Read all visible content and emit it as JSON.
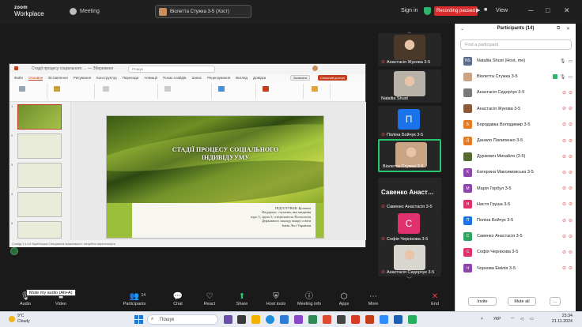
{
  "topbar": {
    "logo_line1": "zoom",
    "logo_line2": "Workplace",
    "meeting_label": "Meeting",
    "pinned_speaker": "Віолетта Стужка 3-5 (Хост)",
    "sign_in": "Sign in",
    "recording_label": "Recording paused",
    "view_label": "View",
    "colors": {
      "recording": "#d92b2b",
      "secure": "#2fb56b"
    }
  },
  "ppt": {
    "title_text": "Стадії процесу соціального … — Збережено",
    "search_placeholder": "Пошук",
    "menu": [
      "Файл",
      "Основне",
      "Вставлення",
      "Рисування",
      "Конструктор",
      "Переходи",
      "Анімації",
      "Показ слайдів",
      "Запис",
      "Рецензування",
      "Вигляд",
      "Довідка"
    ],
    "active_menu": "Основне",
    "record_btn": "Записати",
    "share_btn": "Спільний доступ",
    "slide_numbers": [
      "1",
      "2",
      "3",
      "4",
      "5"
    ],
    "slide_heading_line1": "СТАДІЇ ПРОЦЕСУ СОЦІАЛЬНОГО",
    "slide_heading_line2": "ІНДИВІДУУМУ",
    "slide_body": [
      "ПІДГОТУВАВ: Кузьмич",
      "Федорчук: слухачка, яка завдання",
      "курс 5, група 5, спеціальність Психологія",
      "Державного закладу вищої освіти",
      "Імені Лесі Українки"
    ],
    "status_text": "Слайд 1 з 14   Українська   Спеціальні можливості: потрібно переглянути"
  },
  "video_tiles": [
    {
      "name": "Анастасія Жукова 3-5",
      "kind": "photo",
      "muted": true,
      "color": "#4a3828"
    },
    {
      "name": "Nataliia Shust",
      "kind": "photo",
      "muted": false,
      "color": "#b8b2a8"
    },
    {
      "name": "Поліна Бойчук 3-5",
      "kind": "avatar",
      "letter": "П",
      "muted": true,
      "color": "#1a73e8"
    },
    {
      "name": "Віолетта Стужка 3-5",
      "kind": "photo",
      "muted": false,
      "color": "#c9a586",
      "highlighted": true
    },
    {
      "name": "Савенко Анастасія 3-5",
      "kind": "text",
      "big": "Савенко Анаст…",
      "muted": true
    },
    {
      "name": "Софія Чернікова 3-5",
      "kind": "avatar",
      "letter": "С",
      "muted": true,
      "color": "#e0306d"
    },
    {
      "name": "Анастасія Сидорчук 3-5",
      "kind": "photo",
      "muted": true,
      "color": "#d9d5cf"
    }
  ],
  "participants": {
    "title": "Participants (14)",
    "search_placeholder": "Find a participant",
    "invite_label": "Invite",
    "mute_all_label": "Mute all",
    "more_label": "…",
    "list": [
      {
        "initials": "NS",
        "name": "Nataliia Shust (Host, me)",
        "color": "#5b6b8c",
        "mic": "on",
        "cam": "on"
      },
      {
        "initials": "",
        "name": "Віолетта Стужка 3-5",
        "color": "#c9a586",
        "mic": "on",
        "cam": "on",
        "speaking": true
      },
      {
        "initials": "",
        "name": "Анастасія Сидорчук 3-5",
        "color": "#7a7a7a",
        "mic": "off",
        "cam": "off"
      },
      {
        "initials": "",
        "name": "Анастасія Жукова 3-5",
        "color": "#8a5a3a",
        "mic": "off",
        "cam": "off"
      },
      {
        "initials": "Б",
        "name": "Бородавка Володимир 3-5",
        "color": "#e57c22",
        "mic": "off",
        "cam": "off"
      },
      {
        "initials": "Д",
        "name": "Данило Пилипенко 3-5",
        "color": "#e57c22",
        "mic": "off",
        "cam": "off"
      },
      {
        "initials": "",
        "name": "Дуркевич Михайло (3-5)",
        "color": "#556b2f",
        "mic": "off",
        "cam": "off"
      },
      {
        "initials": "К",
        "name": "Катерина Максимовська 3-5",
        "color": "#8e44ad",
        "mic": "off",
        "cam": "off"
      },
      {
        "initials": "М",
        "name": "Марія Горбул 3-5",
        "color": "#8e44ad",
        "mic": "off",
        "cam": "off"
      },
      {
        "initials": "Н",
        "name": "Настя Груша 3-5",
        "color": "#e0306d",
        "mic": "off",
        "cam": "off"
      },
      {
        "initials": "П",
        "name": "Поліна Бойчук 3-5",
        "color": "#1a73e8",
        "mic": "off",
        "cam": "off"
      },
      {
        "initials": "С",
        "name": "Савенко Анастасія 3-5",
        "color": "#2ba55f",
        "mic": "off",
        "cam": "off"
      },
      {
        "initials": "С",
        "name": "Софія Чернікова 3-5",
        "color": "#e0306d",
        "mic": "off",
        "cam": "off"
      },
      {
        "initials": "Ч",
        "name": "Чорнова Емілія 3-5",
        "color": "#8e44ad",
        "mic": "off",
        "cam": "off"
      }
    ]
  },
  "toolbar": {
    "tooltip": "Mute my audio (Alt+A)",
    "items": [
      {
        "id": "audio",
        "label": "Audio",
        "icon": "mic-icon",
        "glyph": "🎙"
      },
      {
        "id": "video",
        "label": "Video",
        "icon": "camera-icon",
        "glyph": "■"
      },
      {
        "id": "participants",
        "label": "Participants",
        "icon": "people-icon",
        "glyph": "👥",
        "badge": "14"
      },
      {
        "id": "chat",
        "label": "Chat",
        "icon": "chat-icon",
        "glyph": "💬"
      },
      {
        "id": "react",
        "label": "React",
        "icon": "heart-icon",
        "glyph": "♡"
      },
      {
        "id": "share",
        "label": "Share",
        "icon": "share-icon",
        "glyph": "⬆"
      },
      {
        "id": "host_tools",
        "label": "Host tools",
        "icon": "shield-icon",
        "glyph": "⛨"
      },
      {
        "id": "meeting_info",
        "label": "Meeting info",
        "icon": "info-icon",
        "glyph": "ⓘ"
      },
      {
        "id": "apps",
        "label": "Apps",
        "icon": "apps-icon",
        "glyph": "⬡"
      },
      {
        "id": "more",
        "label": "More",
        "icon": "more-icon",
        "glyph": "⋯"
      },
      {
        "id": "end",
        "label": "End",
        "icon": "end-icon",
        "glyph": "✕"
      }
    ]
  },
  "taskbar": {
    "weather_temp": "9°C",
    "weather_desc": "Cloudy",
    "search_label": "Пошук",
    "lang": "УКР",
    "time": "23:34",
    "date": "21.11.2024"
  }
}
